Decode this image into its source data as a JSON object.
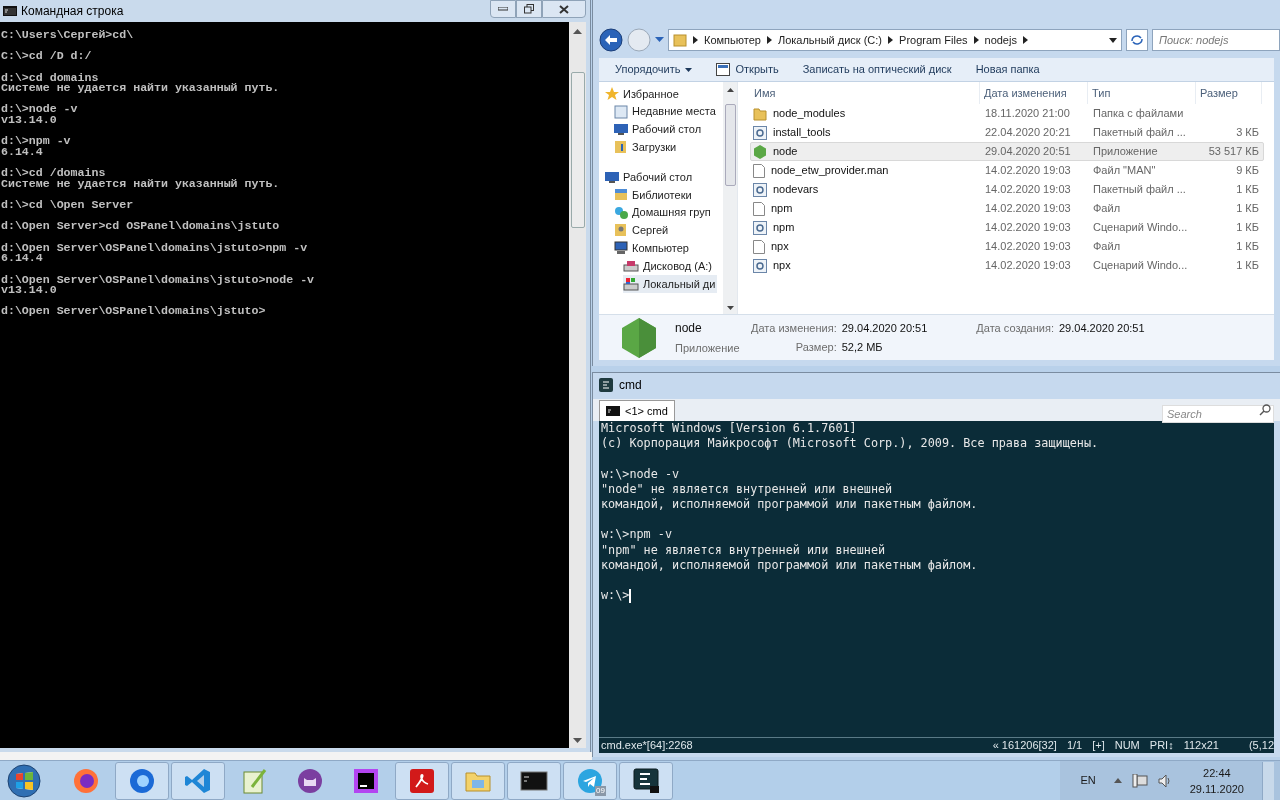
{
  "cmd_window": {
    "title": "Командная строка",
    "blocks": [
      [
        "C:\\Users\\Сергей>cd\\"
      ],
      [
        "C:\\>cd /D d:/"
      ],
      [
        "d:\\>cd domains",
        "Системе не удается найти указанный путь."
      ],
      [
        "d:\\>node -v",
        "v13.14.0"
      ],
      [
        "d:\\>npm -v",
        "6.14.4"
      ],
      [
        "d:\\>cd /domains",
        "Системе не удается найти указанный путь."
      ],
      [
        "d:\\>cd \\Open Server"
      ],
      [
        "d:\\Open Server>cd OSPanel\\domains\\jstuto"
      ],
      [
        "d:\\Open Server\\OSPanel\\domains\\jstuto>npm -v",
        "6.14.4"
      ],
      [
        "d:\\Open Server\\OSPanel\\domains\\jstuto>node -v",
        "v13.14.0"
      ],
      [
        "d:\\Open Server\\OSPanel\\domains\\jstuto>"
      ]
    ]
  },
  "explorer": {
    "breadcrumb": [
      "Компьютер",
      "Локальный диск (C:)",
      "Program Files",
      "nodejs"
    ],
    "search": {
      "placeholder": "Поиск: nodejs"
    },
    "toolbar": [
      {
        "label": "Упорядочить",
        "kind": "menu"
      },
      {
        "label": "Открыть",
        "kind": "open"
      },
      {
        "label": "Записать на оптический диск",
        "kind": "plain"
      },
      {
        "label": "Новая папка",
        "kind": "plain"
      }
    ],
    "nav": [
      {
        "label": "Избранное",
        "kind": "star",
        "selected": false,
        "children": [
          {
            "label": "Недавние места",
            "kind": "recent",
            "selected": false
          },
          {
            "label": "Рабочий стол",
            "kind": "desktop",
            "selected": false
          },
          {
            "label": "Загрузки",
            "kind": "downloads",
            "selected": false
          }
        ]
      },
      {
        "label": "Рабочий стол",
        "kind": "desktop",
        "selected": false,
        "children": [
          {
            "label": "Библиотеки",
            "kind": "libraries",
            "selected": false
          },
          {
            "label": "Домашняя груп",
            "kind": "homegroup",
            "selected": false
          },
          {
            "label": "Сергей",
            "kind": "user",
            "selected": false
          },
          {
            "label": "Компьютер",
            "kind": "computer",
            "selected": false,
            "children": [
              {
                "label": "Дисковод (A:)",
                "kind": "floppy",
                "selected": false
              },
              {
                "label": "Локальный ди",
                "kind": "disk",
                "selected": true
              }
            ]
          }
        ]
      }
    ],
    "columns": [
      "Имя",
      "Дата изменения",
      "Тип",
      "Размер"
    ],
    "files": [
      {
        "name": "node_modules",
        "date": "18.11.2020 21:00",
        "type": "Папка с файлами",
        "kind": "folder",
        "selected": false
      },
      {
        "name": "install_tools",
        "date": "22.04.2020 20:21",
        "type": "Пакетный файл ...",
        "size": "3 КБ",
        "kind": "script",
        "selected": false
      },
      {
        "name": "node",
        "date": "29.04.2020 20:51",
        "type": "Приложение",
        "size": "53 517 КБ",
        "kind": "app",
        "selected": true
      },
      {
        "name": "node_etw_provider.man",
        "date": "14.02.2020 19:03",
        "type": "Файл \"MAN\"",
        "size": "9 КБ",
        "kind": "file",
        "selected": false
      },
      {
        "name": "nodevars",
        "date": "14.02.2020 19:03",
        "type": "Пакетный файл ...",
        "size": "1 КБ",
        "kind": "script",
        "selected": false
      },
      {
        "name": "npm",
        "date": "14.02.2020 19:03",
        "type": "Файл",
        "size": "1 КБ",
        "kind": "file",
        "selected": false
      },
      {
        "name": "npm",
        "date": "14.02.2020 19:03",
        "type": "Сценарий Windo...",
        "size": "1 КБ",
        "kind": "script",
        "selected": false
      },
      {
        "name": "npx",
        "date": "14.02.2020 19:03",
        "type": "Файл",
        "size": "1 КБ",
        "kind": "file",
        "selected": false
      },
      {
        "name": "npx",
        "date": "14.02.2020 19:03",
        "type": "Сценарий Windo...",
        "size": "1 КБ",
        "kind": "script",
        "selected": false
      }
    ],
    "details": {
      "name": "node",
      "type": "Приложение",
      "fields": [
        {
          "label": "Дата изменения:",
          "value": "29.04.2020 20:51"
        },
        {
          "label": "Дата создания:",
          "value": "29.04.2020 20:51"
        },
        {
          "label": "Размер:",
          "value": "52,2 МБ"
        }
      ]
    }
  },
  "conemu": {
    "title": "cmd",
    "tab": {
      "label": "<1> cmd",
      "selected": true
    },
    "search": {
      "placeholder": "Search"
    },
    "blocks": [
      [
        "Microsoft Windows [Version 6.1.7601]",
        "(c) Корпорация Майкрософт (Microsoft Corp.), 2009. Все права защищены."
      ],
      [
        "w:\\>node -v",
        "\"node\" не является внутренней или внешней",
        "командой, исполняемой программой или пакетным файлом."
      ],
      [
        "w:\\>npm -v",
        "\"npm\" не является внутренней или внешней",
        "командой, исполняемой программой или пакетным файлом."
      ],
      [
        "w:\\>"
      ]
    ],
    "status_left": "cmd.exe*[64]:2268",
    "status_right": [
      "« 161206[32]",
      "1/1",
      "[+]",
      "NUM",
      "PRI↕",
      "112x21",
      "(5,12"
    ]
  },
  "taskbar": {
    "items": [
      {
        "kind": "firefox",
        "active": false
      },
      {
        "kind": "firefox-blue",
        "active": true
      },
      {
        "kind": "vscode",
        "active": true
      },
      {
        "kind": "notepad",
        "active": false
      },
      {
        "kind": "cat",
        "active": false
      },
      {
        "kind": "phpstorm",
        "active": false
      },
      {
        "kind": "pdf",
        "active": true
      },
      {
        "kind": "folder",
        "active": true
      },
      {
        "kind": "console",
        "active": true
      },
      {
        "kind": "telegram",
        "active": true,
        "badge": "09"
      },
      {
        "kind": "conemu",
        "active": true
      }
    ],
    "language": "EN",
    "time": "22:44",
    "date": "29.11.2020"
  }
}
